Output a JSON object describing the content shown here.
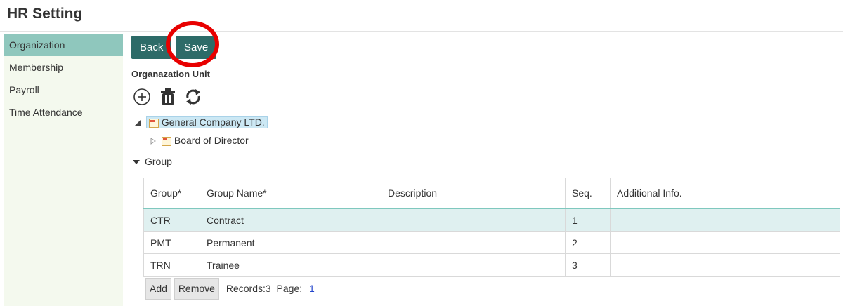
{
  "header": {
    "title": "HR Setting"
  },
  "sidebar": {
    "items": [
      {
        "label": "Organization",
        "active": true
      },
      {
        "label": "Membership"
      },
      {
        "label": "Payroll"
      },
      {
        "label": "Time Attendance"
      }
    ]
  },
  "toolbar": {
    "back_label": "Back",
    "save_label": "Save"
  },
  "org_unit": {
    "section_title": "Organazation Unit",
    "icons": [
      "add-circle-icon",
      "trash-icon",
      "refresh-icon"
    ],
    "tree": [
      {
        "label": "General Company LTD.",
        "selected": true
      },
      {
        "label": "Board of Director"
      }
    ]
  },
  "group": {
    "toggle_label": "Group",
    "columns": [
      "Group*",
      "Group Name*",
      "Description",
      "Seq.",
      "Additional Info."
    ],
    "rows": [
      {
        "code": "CTR",
        "name": "Contract",
        "description": "",
        "seq": "1",
        "info": ""
      },
      {
        "code": "PMT",
        "name": "Permanent",
        "description": "",
        "seq": "2",
        "info": ""
      },
      {
        "code": "TRN",
        "name": "Trainee",
        "description": "",
        "seq": "3",
        "info": ""
      }
    ],
    "add_label": "Add",
    "remove_label": "Remove",
    "records_text": "Records:3",
    "page_label": "Page:",
    "page_number": "1"
  },
  "colors": {
    "accent": "#2d6b68",
    "sidebar_active": "#8fc7bd",
    "sidebar_bg": "#f4f9ee",
    "annotation_ring": "#e80000",
    "selected_row": "#dff0f0"
  }
}
